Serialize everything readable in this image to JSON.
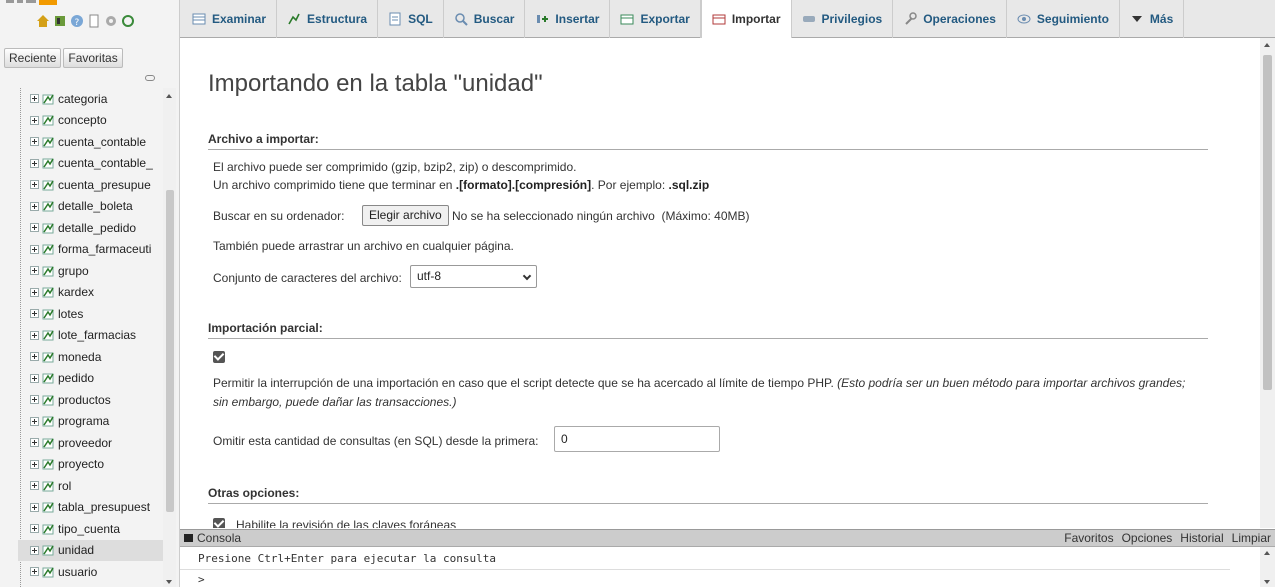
{
  "nav": {
    "tabs": [
      "Reciente",
      "Favoritas"
    ],
    "tables": [
      "categoria",
      "concepto",
      "cuenta_contable",
      "cuenta_contable_",
      "cuenta_presupue",
      "detalle_boleta",
      "detalle_pedido",
      "forma_farmaceuti",
      "grupo",
      "kardex",
      "lotes",
      "lote_farmacias",
      "moneda",
      "pedido",
      "productos",
      "programa",
      "proveedor",
      "proyecto",
      "rol",
      "tabla_presupuest",
      "tipo_cuenta",
      "unidad",
      "usuario"
    ],
    "active_table": "unidad"
  },
  "tabs": [
    "Examinar",
    "Estructura",
    "SQL",
    "Buscar",
    "Insertar",
    "Exportar",
    "Importar",
    "Privilegios",
    "Operaciones",
    "Seguimiento",
    "Más"
  ],
  "active_tab": "Importar",
  "page": {
    "title": "Importando en la tabla \"unidad\"",
    "file_section": {
      "heading": "Archivo a importar:",
      "line1": "El archivo puede ser comprimido (gzip, bzip2, zip) o descomprimido.",
      "line2_prefix": "Un archivo comprimido tiene que terminar en ",
      "line2_format": ".[formato].[compresión]",
      "line2_mid": ". Por ejemplo: ",
      "line2_example": ".sql.zip",
      "browse_label": "Buscar en su ordenador:",
      "browse_button": "Elegir archivo",
      "no_file": "No se ha seleccionado ningún archivo",
      "max_size": "(Máximo: 40MB)",
      "drag_hint": "También puede arrastrar un archivo en cualquier página.",
      "charset_label": "Conjunto de caracteres del archivo:",
      "charset_value": "utf-8"
    },
    "partial_section": {
      "heading": "Importación parcial:",
      "allow_interrupt_checked": true,
      "interrupt_text": "Permitir la interrupción de una importación en caso que el script detecte que se ha acercado al límite de tiempo PHP.",
      "interrupt_note_1": "(Esto podría ser un buen método para importar archivos grandes;",
      "interrupt_note_2": "sin embargo, puede dañar las transacciones.)",
      "skip_label": "Omitir esta cantidad de consultas (en SQL) desde la primera:",
      "skip_value": "0"
    },
    "other_section": {
      "heading": "Otras opciones:",
      "fk_checked": true,
      "fk_label": "Habilite la revisión de las claves foráneas"
    }
  },
  "console": {
    "title": "Consola",
    "links": [
      "Favoritos",
      "Opciones",
      "Historial",
      "Limpiar"
    ],
    "hint": "Presione Ctrl+Enter para ejecutar la consulta",
    "prompt": ">"
  }
}
